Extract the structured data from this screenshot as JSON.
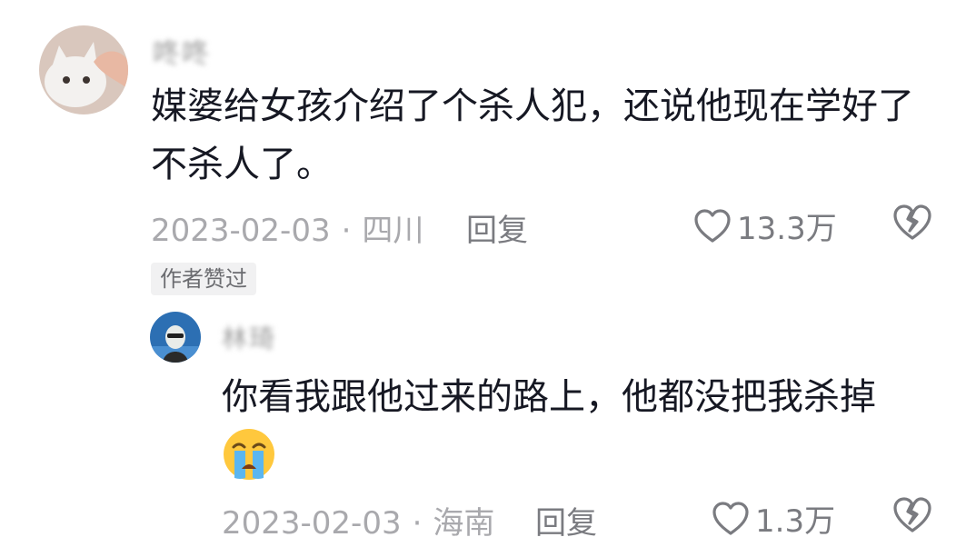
{
  "comment": {
    "username": "咚咚",
    "text_line1": "媒婆给女孩介绍了个杀人犯，还说他现在学好了",
    "text_line2": "不杀人了。",
    "date": "2023-02-03",
    "separator": "·",
    "location": "四川",
    "reply_label": "回复",
    "like_count": "13.3万",
    "author_liked_badge": "作者赞过"
  },
  "reply": {
    "username": "林琦",
    "text": "你看我跟他过来的路上，他都没把我杀掉",
    "emoji": "crying-face-emoji",
    "date": "2023-02-03",
    "separator": "·",
    "location": "海南",
    "reply_label": "回复",
    "like_count": "1.3万"
  },
  "icons": {
    "like": "heart-outline-icon",
    "dislike": "broken-heart-icon"
  },
  "colors": {
    "text_primary": "#161823",
    "text_meta": "#a9a9ad",
    "text_action": "#7a7b80",
    "badge_bg": "#f1f1f2"
  }
}
